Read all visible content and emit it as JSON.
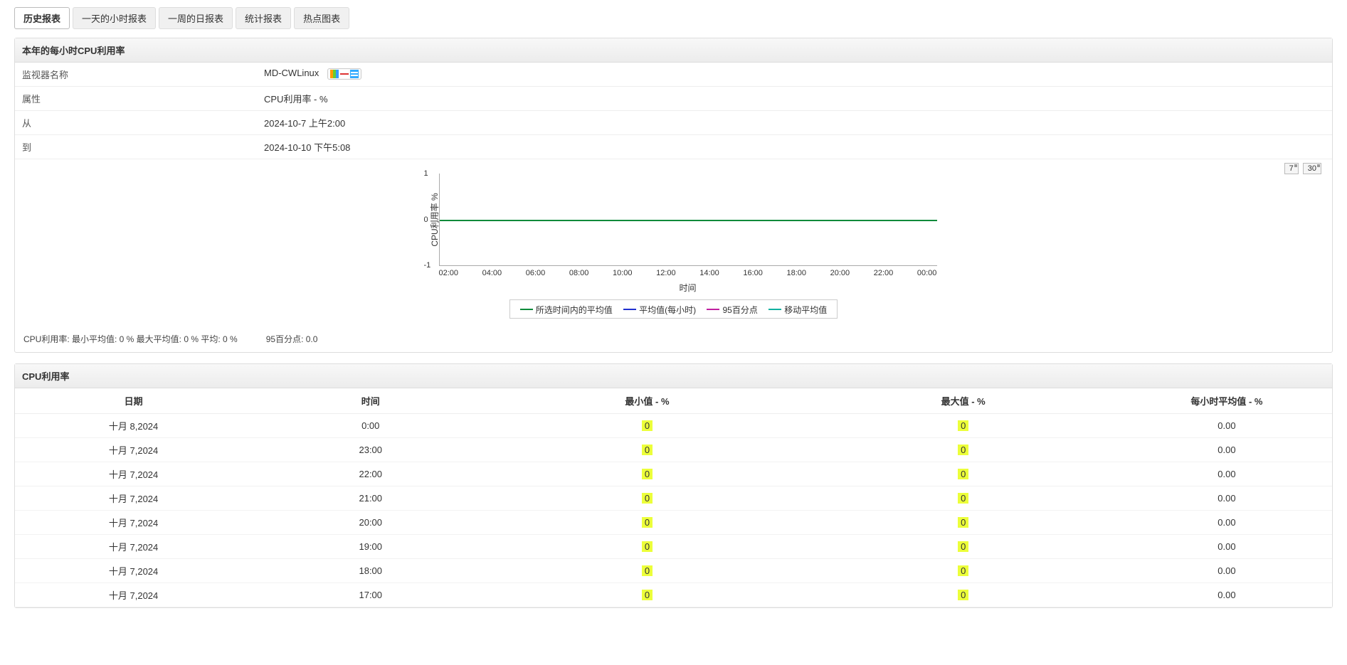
{
  "tabs": {
    "history": "历史报表",
    "hourly_day": "一天的小时报表",
    "daily_week": "一周的日报表",
    "stats": "统计报表",
    "hotspot": "热点图表"
  },
  "panel1": {
    "title": "本年的每小时CPU利用率",
    "rows": {
      "monitor_label": "监视器名称",
      "monitor_value": "MD-CWLinux",
      "attr_label": "属性",
      "attr_value": "CPU利用率 - %",
      "from_label": "从",
      "from_value": "2024-10-7 上午2:00",
      "to_label": "到",
      "to_value": "2024-10-10 下午5:08"
    },
    "range_buttons": {
      "d7": "7",
      "d30": "30"
    },
    "stats_line": "CPU利用率:   最小平均值:  0  % 最大平均值:  0  % 平均:  0  %",
    "p95_line": "95百分点:  0.0"
  },
  "chart_data": {
    "type": "line",
    "title": "",
    "ylabel": "CPU利用率 %",
    "xlabel": "时间",
    "ylim": [
      -1,
      1
    ],
    "yticks": [
      "1",
      "0",
      "-1"
    ],
    "xticks": [
      "02:00",
      "04:00",
      "06:00",
      "08:00",
      "10:00",
      "12:00",
      "14:00",
      "16:00",
      "18:00",
      "20:00",
      "22:00",
      "00:00"
    ],
    "series": [
      {
        "name": "所选时间内的平均值",
        "color": "#0a8a3a",
        "values": [
          0,
          0,
          0,
          0,
          0,
          0,
          0,
          0,
          0,
          0,
          0,
          0
        ]
      },
      {
        "name": "平均值(每小时)",
        "color": "#2030d0",
        "values": [
          0,
          0,
          0,
          0,
          0,
          0,
          0,
          0,
          0,
          0,
          0,
          0
        ]
      },
      {
        "name": "95百分点",
        "color": "#c020a0",
        "values": [
          0,
          0,
          0,
          0,
          0,
          0,
          0,
          0,
          0,
          0,
          0,
          0
        ]
      },
      {
        "name": "移动平均值",
        "color": "#10b0a0",
        "values": [
          0,
          0,
          0,
          0,
          0,
          0,
          0,
          0,
          0,
          0,
          0,
          0
        ]
      }
    ]
  },
  "panel2": {
    "title": "CPU利用率",
    "headers": {
      "date": "日期",
      "time": "时间",
      "min": "最小值 - %",
      "max": "最大值 - %",
      "avg": "每小时平均值 - %"
    },
    "rows": [
      {
        "date": "十月 8,2024",
        "time": "0:00",
        "min": "0",
        "max": "0",
        "avg": "0.00"
      },
      {
        "date": "十月 7,2024",
        "time": "23:00",
        "min": "0",
        "max": "0",
        "avg": "0.00"
      },
      {
        "date": "十月 7,2024",
        "time": "22:00",
        "min": "0",
        "max": "0",
        "avg": "0.00"
      },
      {
        "date": "十月 7,2024",
        "time": "21:00",
        "min": "0",
        "max": "0",
        "avg": "0.00"
      },
      {
        "date": "十月 7,2024",
        "time": "20:00",
        "min": "0",
        "max": "0",
        "avg": "0.00"
      },
      {
        "date": "十月 7,2024",
        "time": "19:00",
        "min": "0",
        "max": "0",
        "avg": "0.00"
      },
      {
        "date": "十月 7,2024",
        "time": "18:00",
        "min": "0",
        "max": "0",
        "avg": "0.00"
      },
      {
        "date": "十月 7,2024",
        "time": "17:00",
        "min": "0",
        "max": "0",
        "avg": "0.00"
      }
    ]
  }
}
